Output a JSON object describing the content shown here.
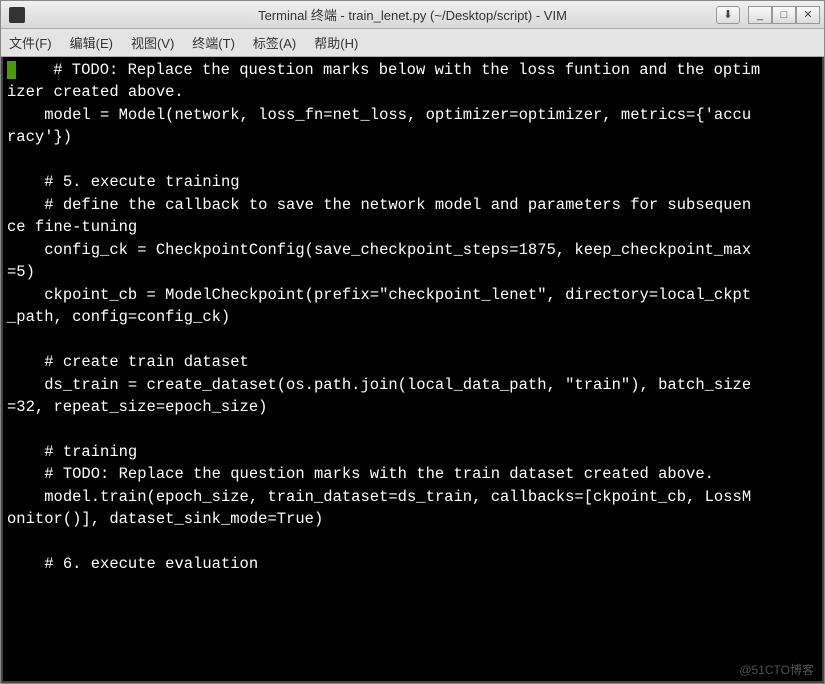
{
  "window": {
    "title": "Terminal 终端 - train_lenet.py (~/Desktop/script) - VIM"
  },
  "controls": {
    "pin": "⬇",
    "min": "_",
    "max": "□",
    "close": "✕"
  },
  "menu": {
    "file": "文件(F)",
    "edit": "编辑(E)",
    "view": "视图(V)",
    "terminal": "终端(T)",
    "tabs": "标签(A)",
    "help": "帮助(H)"
  },
  "code": {
    "l1": "    # TODO: Replace the question marks below with the loss funtion and the optim",
    "l2": "izer created above.",
    "l3": "    model = Model(network, loss_fn=net_loss, optimizer=optimizer, metrics={'accu",
    "l4": "racy'})",
    "l5": "",
    "l6": "    # 5. execute training",
    "l7": "    # define the callback to save the network model and parameters for subsequen",
    "l8": "ce fine-tuning",
    "l9": "    config_ck = CheckpointConfig(save_checkpoint_steps=1875, keep_checkpoint_max",
    "l10": "=5)",
    "l11": "    ckpoint_cb = ModelCheckpoint(prefix=\"checkpoint_lenet\", directory=local_ckpt",
    "l12": "_path, config=config_ck)",
    "l13": "",
    "l14": "    # create train dataset",
    "l15": "    ds_train = create_dataset(os.path.join(local_data_path, \"train\"), batch_size",
    "l16": "=32, repeat_size=epoch_size)",
    "l17": "",
    "l18": "    # training",
    "l19": "    # TODO: Replace the question marks with the train dataset created above.",
    "l20": "    model.train(epoch_size, train_dataset=ds_train, callbacks=[ckpoint_cb, LossM",
    "l21": "onitor()], dataset_sink_mode=True)",
    "l22": "",
    "l23": "    # 6. execute evaluation"
  },
  "watermark": "@51CTO博客"
}
